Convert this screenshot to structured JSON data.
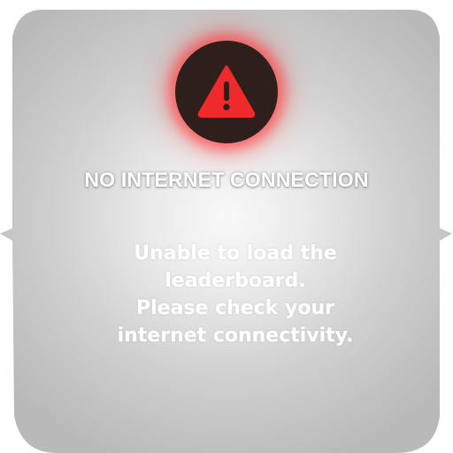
{
  "dialog": {
    "icon": "warning-triangle-icon",
    "accent_color": "#ee2a2a",
    "icon_background": "#2e1e1c",
    "title": "NO INTERNET CONNECTION",
    "message_lines": [
      "Unable to load the",
      "leaderboard.",
      "Please check your",
      "internet connectivity."
    ]
  }
}
